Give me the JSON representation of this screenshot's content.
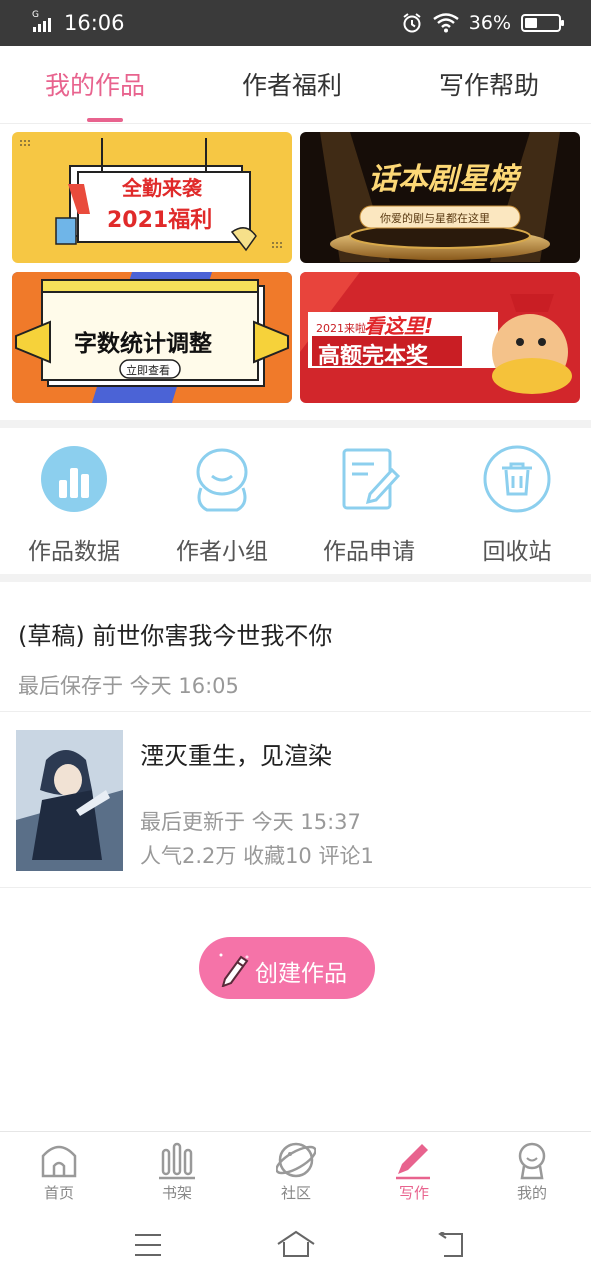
{
  "status_bar": {
    "time": "16:06",
    "network": "G",
    "battery_text": "36%",
    "battery_level": 0.36
  },
  "tabs": [
    {
      "label": "我的作品",
      "active": true
    },
    {
      "label": "作者福利",
      "active": false
    },
    {
      "label": "写作帮助",
      "active": false
    }
  ],
  "banners": [
    {
      "title": "全勤来袭",
      "subtitle": "2021福利"
    },
    {
      "title": "话本剧星榜",
      "subtitle": "你爱的剧与星都在这里"
    },
    {
      "title": "字数统计调整",
      "subtitle": "立即查看"
    },
    {
      "tag": "2021来啦",
      "title": "看这里!",
      "subtitle": "高额完本奖"
    }
  ],
  "quick_actions": [
    {
      "label": "作品数据",
      "icon": "bar-chart-icon"
    },
    {
      "label": "作者小组",
      "icon": "group-icon"
    },
    {
      "label": "作品申请",
      "icon": "edit-document-icon"
    },
    {
      "label": "回收站",
      "icon": "trash-icon"
    }
  ],
  "draft": {
    "title": "(草稿) 前世你害我今世我不你",
    "meta": "最后保存于 今天 16:05"
  },
  "work": {
    "title": "湮灭重生，见渲染",
    "updated": "最后更新于 今天 15:37",
    "stats": "人气2.2万 收藏10 评论1"
  },
  "create_button": {
    "label": "创建作品"
  },
  "bottom_nav": [
    {
      "label": "首页",
      "icon": "home-icon",
      "active": false
    },
    {
      "label": "书架",
      "icon": "bookshelf-icon",
      "active": false
    },
    {
      "label": "社区",
      "icon": "planet-icon",
      "active": false
    },
    {
      "label": "写作",
      "icon": "pen-icon",
      "active": true
    },
    {
      "label": "我的",
      "icon": "profile-icon",
      "active": false
    }
  ],
  "colors": {
    "accent": "#e8638e",
    "button": "#f573a8",
    "icon_blue": "#8ccfee"
  }
}
